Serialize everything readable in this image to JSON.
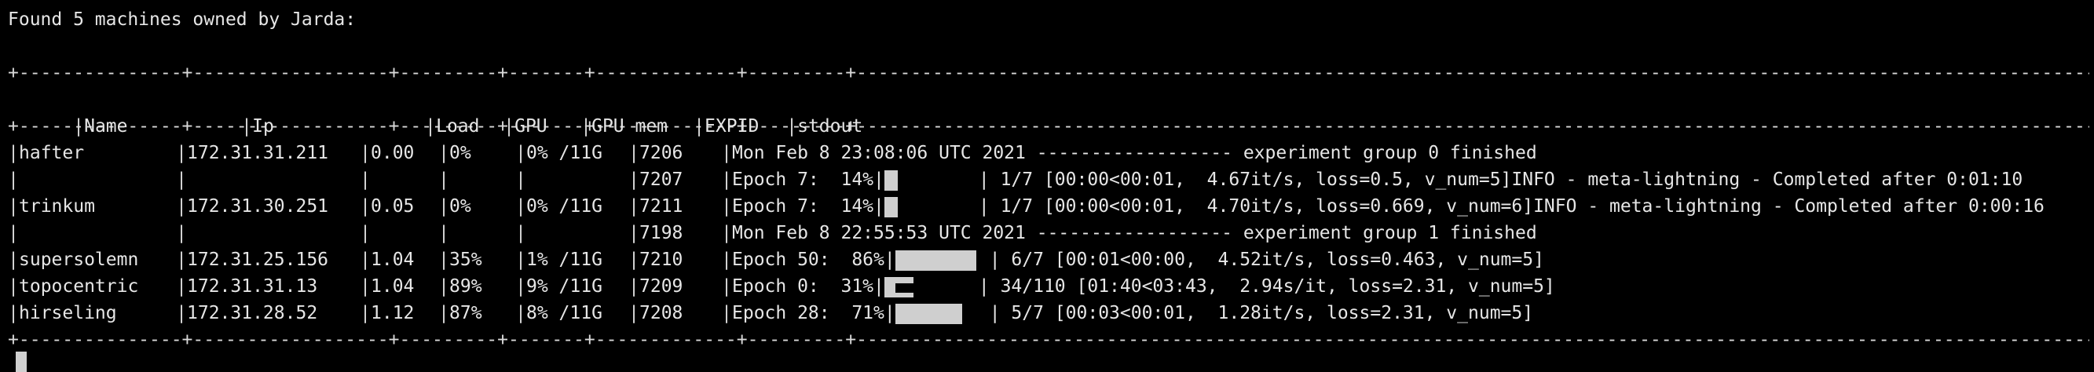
{
  "header": "Found 5 machines owned by Jarda:",
  "rule": "+---------------+------------------+---------+-------+-------------+---------+---------------------------------------------------------------------------------------------------------------------------------------------------------------------------------------------------------------------+",
  "columns": [
    "Name",
    "Ip",
    "Load",
    "GPU",
    "GPU mem",
    "EXPID",
    "stdout"
  ],
  "rows": [
    {
      "name": "hafter",
      "ip": "172.31.31.211",
      "load": "0.00",
      "gpu": "0%",
      "mem": "0% /11G",
      "expid": "7206",
      "stdout": "Mon Feb 8 23:08:06 UTC 2021 ------------------ experiment group 0 finished",
      "progress": null
    },
    {
      "name": "",
      "ip": "",
      "load": "",
      "gpu": "",
      "mem": "",
      "expid": "7207",
      "stdout_pre": "Epoch 7:  14%|",
      "stdout_post": "| 1/7 [00:00<00:01,  4.67it/s, loss=0.5, v_num=5]INFO - meta-lightning - Completed after 0:01:10",
      "progress": 0.14
    },
    {
      "name": "trinkum",
      "ip": "172.31.30.251",
      "load": "0.05",
      "gpu": "0%",
      "mem": "0% /11G",
      "expid": "7211",
      "stdout_pre": "Epoch 7:  14%|",
      "stdout_post": "| 1/7 [00:00<00:01,  4.70it/s, loss=0.669, v_num=6]INFO - meta-lightning - Completed after 0:00:16",
      "progress": 0.14
    },
    {
      "name": "",
      "ip": "",
      "load": "",
      "gpu": "",
      "mem": "",
      "expid": "7198",
      "stdout": "Mon Feb 8 22:55:53 UTC 2021 ------------------ experiment group 1 finished",
      "progress": null
    },
    {
      "name": "supersolemn",
      "ip": "172.31.25.156",
      "load": "1.04",
      "gpu": "35%",
      "mem": "1% /11G",
      "expid": "7210",
      "stdout_pre": "Epoch 50:  86%|",
      "stdout_post": "| 6/7 [00:01<00:00,  4.52it/s, loss=0.463, v_num=5]",
      "progress": 0.86
    },
    {
      "name": "topocentric",
      "ip": "172.31.31.13",
      "load": "1.04",
      "gpu": "89%",
      "mem": "9% /11G",
      "expid": "7209",
      "stdout_pre": "Epoch 0:  31%|",
      "stdout_post": "| 34/110 [01:40<03:43,  2.94s/it, loss=2.31, v_num=5]",
      "progress": 0.31
    },
    {
      "name": "hirseling",
      "ip": "172.31.28.52",
      "load": "1.12",
      "gpu": "87%",
      "mem": "8% /11G",
      "expid": "7208",
      "stdout_pre": "Epoch 28:  71%|",
      "stdout_post": "| 5/7 [00:03<00:01,  1.28it/s, loss=2.31, v_num=5]",
      "progress": 0.71
    }
  ],
  "colors": {
    "background": "#000000",
    "text": "#e6e6e6",
    "bar": "#cfcfcf"
  }
}
